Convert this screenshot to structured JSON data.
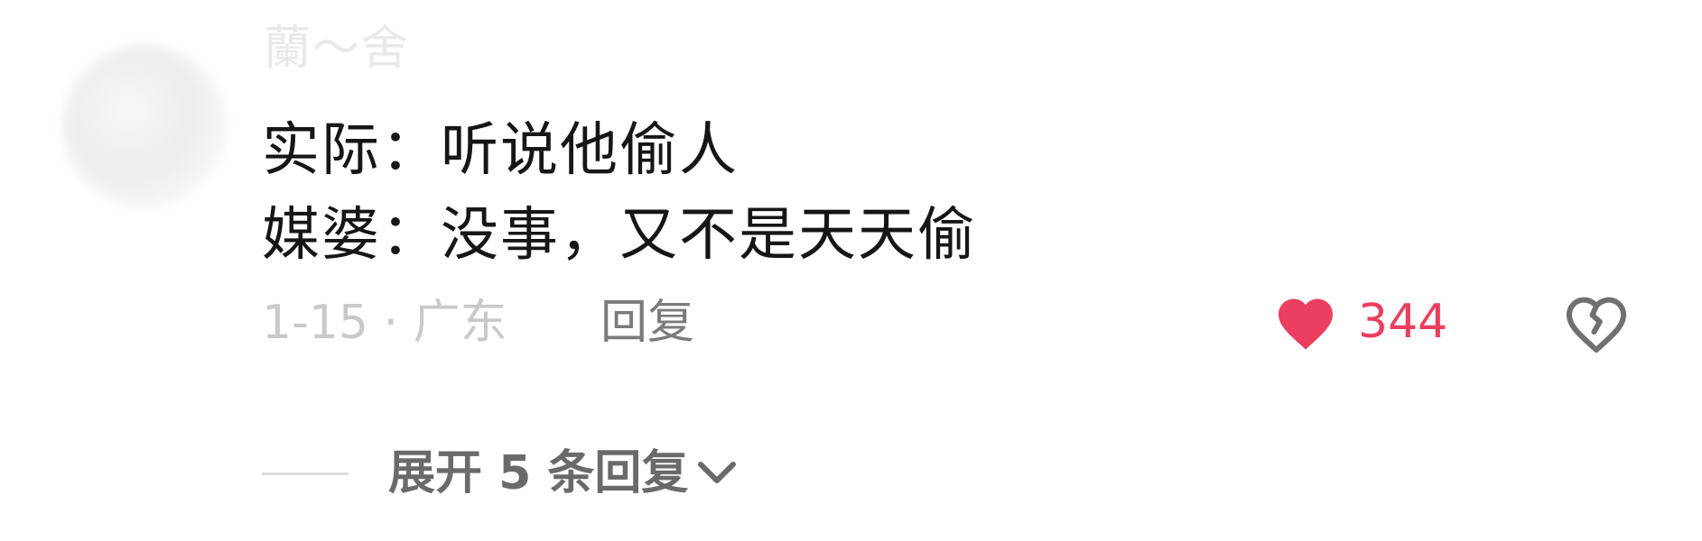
{
  "comment": {
    "username": "蘭～舍",
    "lines": [
      "实际：听说他偷人",
      "媒婆：没事，又不是天天偷"
    ],
    "date_location": "1-15 · 广东",
    "reply_label": "回复",
    "like_count": "344",
    "liked": true,
    "expand_replies_label": "展开 5 条回复"
  },
  "colors": {
    "like_red": "#ec3e5e",
    "text_primary": "#161616",
    "text_meta": "#c9c9c9",
    "text_secondary": "#7b7b7b"
  },
  "icons": {
    "like": "heart-icon",
    "dislike": "broken-heart-icon",
    "expand": "chevron-down-icon"
  }
}
